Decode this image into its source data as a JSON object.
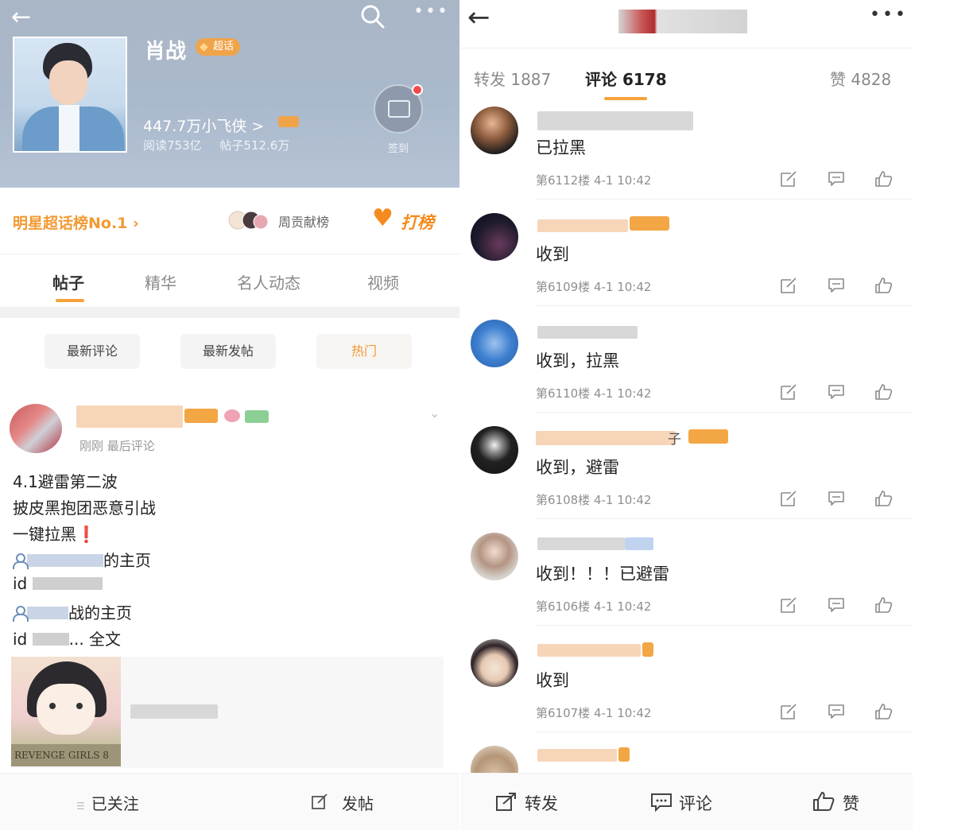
{
  "left": {
    "header": {
      "name": "肖战",
      "super_badge": "超话",
      "fans": "447.7万小飞侠 >",
      "stats": "阅读753亿 帖子512.6万",
      "checkin": "签到"
    },
    "rank": {
      "label": "明星超话榜No.1 ›",
      "contrib": "周贡献榜",
      "dabang": "打榜"
    },
    "tabs": [
      "帖子",
      "精华",
      "名人动态",
      "视频"
    ],
    "filters": [
      "最新评论",
      "最新发帖",
      "热门"
    ],
    "post": {
      "meta": "刚刚 最后评论",
      "lines": [
        "4.1避雷第二波",
        "披皮黑抱团恶意引战",
        "一键拉黑"
      ],
      "excl": "❗",
      "homepage1_suffix": "的主页",
      "id_label": "id",
      "homepage2_suffix": "战的主页",
      "fulltext": "... 全文",
      "img_banner": "REVENGE GIRLS 8"
    },
    "bottom": {
      "follow": "已关注",
      "post": "发帖"
    }
  },
  "right": {
    "tabs": {
      "repost": "转发 1887",
      "comment": "评论 6178",
      "like": "赞 4828"
    },
    "comments": [
      {
        "text": "已拉黑",
        "meta": "第6112楼 4-1 10:42"
      },
      {
        "text": "收到",
        "meta": "第6109楼 4-1 10:42"
      },
      {
        "text": "收到，拉黑",
        "meta": "第6110楼 4-1 10:42"
      },
      {
        "text": "收到，避雷",
        "meta": "第6108楼 4-1 10:42",
        "name_suffix": "子"
      },
      {
        "text": "收到！！！已避雷",
        "meta": "第6106楼 4-1 10:42"
      },
      {
        "text": "收到",
        "meta": "第6107楼 4-1 10:42"
      }
    ],
    "bottom": {
      "repost": "转发",
      "comment": "评论",
      "like": "赞"
    }
  },
  "colors": {
    "accent": "#f5a23b",
    "orange_text": "#f58b1f",
    "hero_bg": "#aab9cc"
  }
}
